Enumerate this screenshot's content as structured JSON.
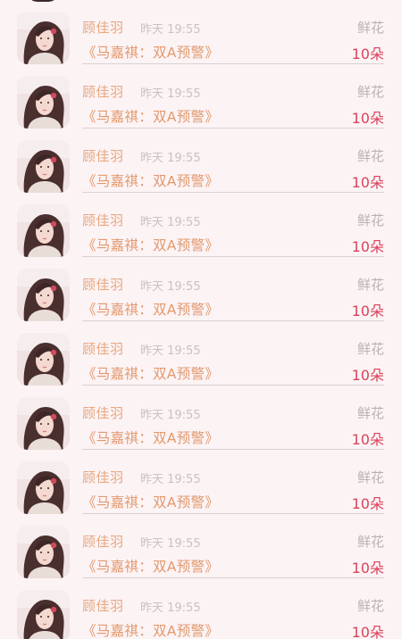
{
  "gift_items": [
    {
      "sender": "顾佳羽",
      "time": "昨天 19:55",
      "gift_name": "鲜花",
      "message": "《马嘉祺：双A预警》",
      "quantity": "10朵"
    },
    {
      "sender": "顾佳羽",
      "time": "昨天 19:55",
      "gift_name": "鲜花",
      "message": "《马嘉祺：双A预警》",
      "quantity": "10朵"
    },
    {
      "sender": "顾佳羽",
      "time": "昨天 19:55",
      "gift_name": "鲜花",
      "message": "《马嘉祺：双A预警》",
      "quantity": "10朵"
    },
    {
      "sender": "顾佳羽",
      "time": "昨天 19:55",
      "gift_name": "鲜花",
      "message": "《马嘉祺：双A预警》",
      "quantity": "10朵"
    },
    {
      "sender": "顾佳羽",
      "time": "昨天 19:55",
      "gift_name": "鲜花",
      "message": "《马嘉祺：双A预警》",
      "quantity": "10朵"
    },
    {
      "sender": "顾佳羽",
      "time": "昨天 19:55",
      "gift_name": "鲜花",
      "message": "《马嘉祺：双A预警》",
      "quantity": "10朵"
    },
    {
      "sender": "顾佳羽",
      "time": "昨天 19:55",
      "gift_name": "鲜花",
      "message": "《马嘉祺：双A预警》",
      "quantity": "10朵"
    },
    {
      "sender": "顾佳羽",
      "time": "昨天 19:55",
      "gift_name": "鲜花",
      "message": "《马嘉祺：双A预警》",
      "quantity": "10朵"
    },
    {
      "sender": "顾佳羽",
      "time": "昨天 19:55",
      "gift_name": "鲜花",
      "message": "《马嘉祺：双A预警》",
      "quantity": "10朵"
    },
    {
      "sender": "顾佳羽",
      "time": "昨天 19:55",
      "gift_name": "鲜花",
      "message": "《马嘉祺：双A预警》",
      "quantity": "10朵"
    }
  ],
  "colors": {
    "background": "#fcf3f5",
    "sender": "#e7a77f",
    "time": "#c8c2c2",
    "gift_name": "#b9b3b3",
    "message": "#e29a6e",
    "quantity": "#d9435a",
    "divider": "#d8d2d3"
  },
  "icons": {
    "avatar": "user-avatar-photo"
  }
}
